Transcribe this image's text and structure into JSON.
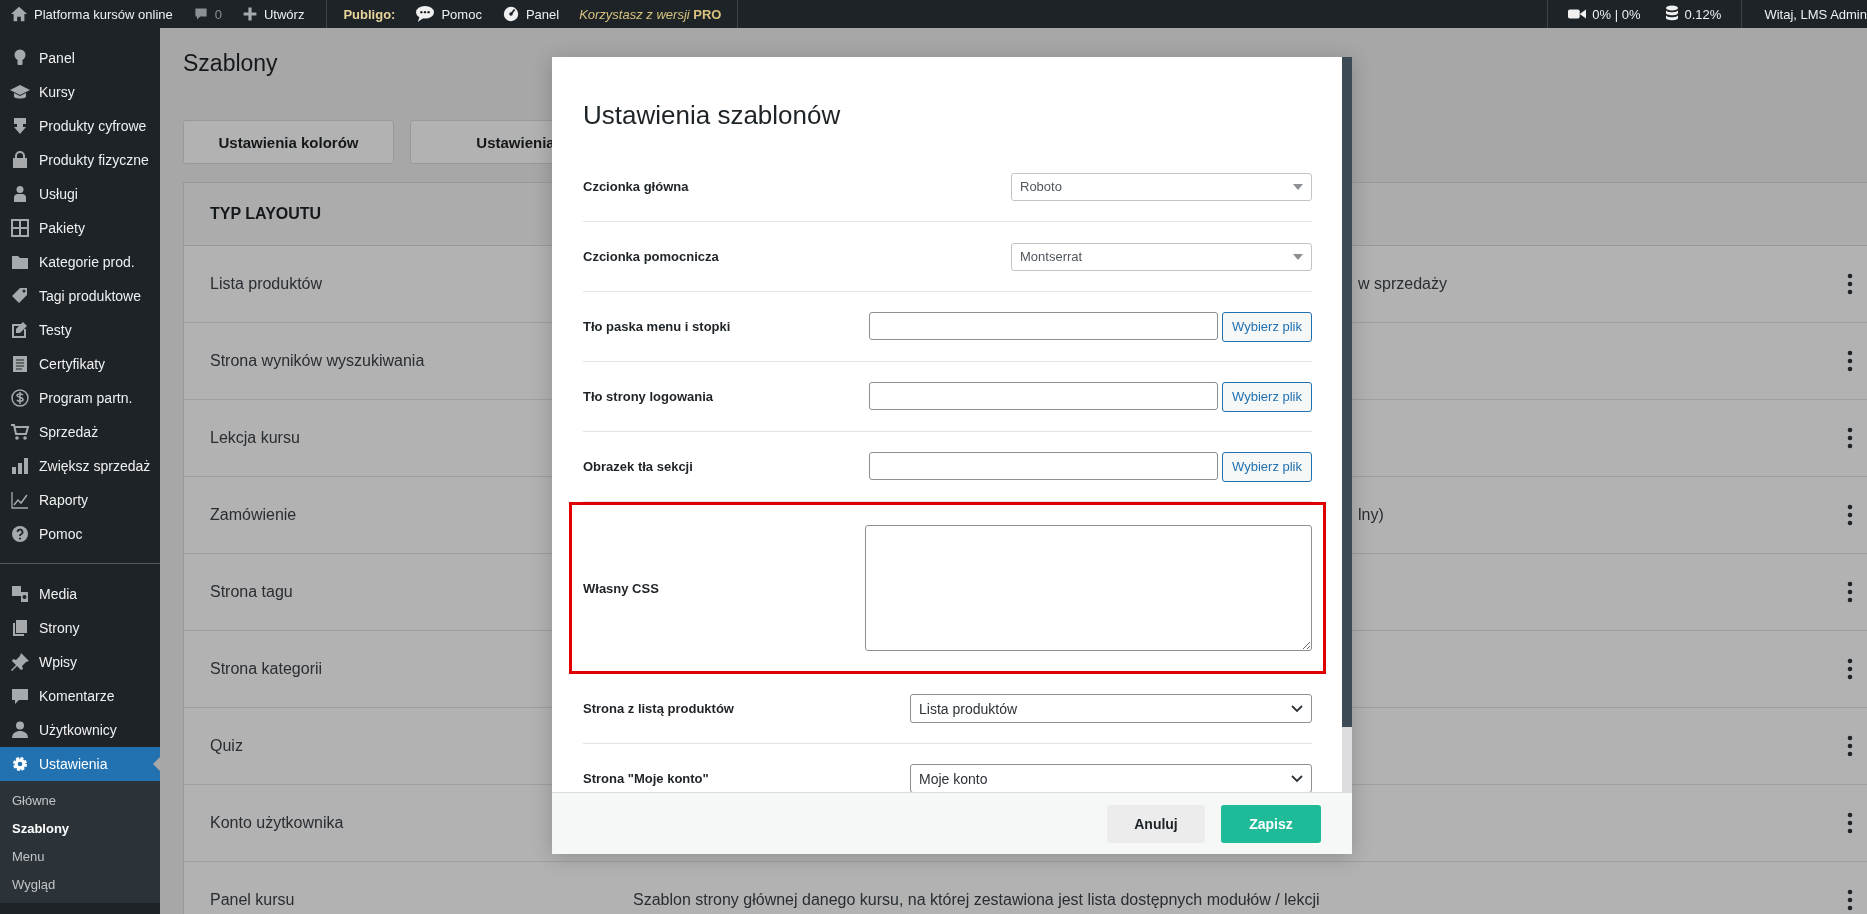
{
  "top_bar": {
    "site": "Platforma kursów online",
    "comments": "0",
    "new_label": "Utwórz",
    "plugin": {
      "label": "Publigo:",
      "help": "Pomoc",
      "panel": "Panel",
      "promo": "*Korzystasz z wersji* **PRO**"
    },
    "stats": [
      {
        "kind": "video",
        "text": "0% | 0%"
      },
      {
        "kind": "database",
        "text": "0.12%"
      }
    ],
    "greeting": "Witaj, LMS Admin"
  },
  "sidebar": {
    "groups": [
      [
        {
          "label": "Panel",
          "selected": false
        },
        {
          "label": "Kursy",
          "selected": false
        },
        {
          "label": "Produkty cyfrowe",
          "selected": false
        },
        {
          "label": "Produkty fizyczne",
          "selected": false
        },
        {
          "label": "Usługi",
          "selected": false
        },
        {
          "label": "Pakiety",
          "selected": false
        },
        {
          "label": "Kategorie prod.",
          "selected": false
        },
        {
          "label": "Tagi produktowe",
          "selected": false
        },
        {
          "label": "Testy",
          "selected": false
        },
        {
          "label": "Certyfikaty",
          "selected": false
        },
        {
          "label": "Program partn.",
          "selected": false
        },
        {
          "label": "Sprzedaż",
          "selected": false
        },
        {
          "label": "Zwiększ sprzedaż",
          "selected": false
        },
        {
          "label": "Raporty",
          "selected": false
        },
        {
          "label": "Pomoc",
          "selected": false
        }
      ],
      [
        {
          "label": "Media",
          "selected": false
        },
        {
          "label": "Strony",
          "selected": false
        },
        {
          "label": "Wpisy",
          "selected": false
        },
        {
          "label": "Komentarze",
          "selected": false
        },
        {
          "label": "Użytkownicy",
          "selected": false
        },
        {
          "label": "Ustawienia",
          "selected": true
        }
      ]
    ],
    "submenu": [
      {
        "label": "Główne",
        "selected": false
      },
      {
        "label": "Szablony",
        "selected": true
      },
      {
        "label": "Menu",
        "selected": false
      },
      {
        "label": "Wygląd",
        "selected": false
      }
    ]
  },
  "page": {
    "title": "Szablony",
    "tabs": [
      "Ustawienia kolorów",
      "Ustawienia"
    ],
    "table": {
      "header": "TYP LAYOUTU",
      "rows": [
        {
          "name": "Lista produktów",
          "description": "w sprzedaży",
          "covered": true
        },
        {
          "name": "Strona wyników wyszukiwania"
        },
        {
          "name": "Lekcja kursu"
        },
        {
          "name": "Zamówienie",
          "description": "lny)",
          "covered": true
        },
        {
          "name": "Strona tagu"
        },
        {
          "name": "Strona kategorii"
        },
        {
          "name": "Quiz"
        },
        {
          "name": "Konto użytkownika"
        },
        {
          "name": "Panel kursu",
          "description": "Szablon strony głównej danego kursu, na której zestawiona jest lista dostępnych modułów / lekcji",
          "covered": false
        }
      ]
    }
  },
  "modal": {
    "title": "Ustawienia szablonów",
    "fields": [
      {
        "kind": "font-select",
        "label": "Czcionka główna",
        "value": "Roboto"
      },
      {
        "kind": "font-select",
        "label": "Czcionka pomocnicza",
        "value": "Montserrat"
      },
      {
        "kind": "file",
        "label": "Tło paska menu i stopki",
        "button": "Wybierz plik"
      },
      {
        "kind": "file",
        "label": "Tło strony logowania",
        "button": "Wybierz plik"
      },
      {
        "kind": "file",
        "label": "Obrazek tła sekcji",
        "button": "Wybierz plik"
      },
      {
        "kind": "textarea",
        "label": "Własny CSS",
        "highlighted": true
      },
      {
        "kind": "page-select",
        "label": "Strona z listą produktów",
        "value": "Lista produktów"
      },
      {
        "kind": "page-select",
        "label": "Strona \"Moje konto\"",
        "value": "Moje konto"
      }
    ],
    "buttons": [
      {
        "label": "Anuluj",
        "kind": "secondary"
      },
      {
        "label": "Zapisz",
        "kind": "primary"
      }
    ]
  }
}
